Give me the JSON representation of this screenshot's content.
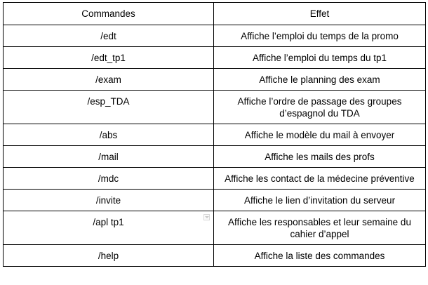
{
  "table": {
    "headers": {
      "command": "Commandes",
      "effect": "Effet"
    },
    "rows": [
      {
        "command": "/edt",
        "effect": "Affiche l’emploi du temps de la promo"
      },
      {
        "command": "/edt_tp1",
        "effect": "Affiche l’emploi du temps du tp1"
      },
      {
        "command": "/exam",
        "effect": "Affiche le planning des exam"
      },
      {
        "command": "/esp_TDA",
        "effect": "Affiche l’ordre de passage des groupes d’espagnol du TDA"
      },
      {
        "command": "/abs",
        "effect": "Affiche le modèle du mail à envoyer"
      },
      {
        "command": "/mail",
        "effect": "Affiche les mails des profs"
      },
      {
        "command": "/mdc",
        "effect": "Affiche les contact de la médecine préventive"
      },
      {
        "command": "/invite",
        "effect": "Affiche le lien d’invitation du serveur"
      },
      {
        "command": "/apl tp1",
        "effect": "Affiche les responsables et leur semaine du cahier d’appel"
      },
      {
        "command": "/help",
        "effect": "Affiche la liste des commandes"
      }
    ]
  },
  "icons": {
    "dropdown_marker": "chevron-down-icon"
  }
}
